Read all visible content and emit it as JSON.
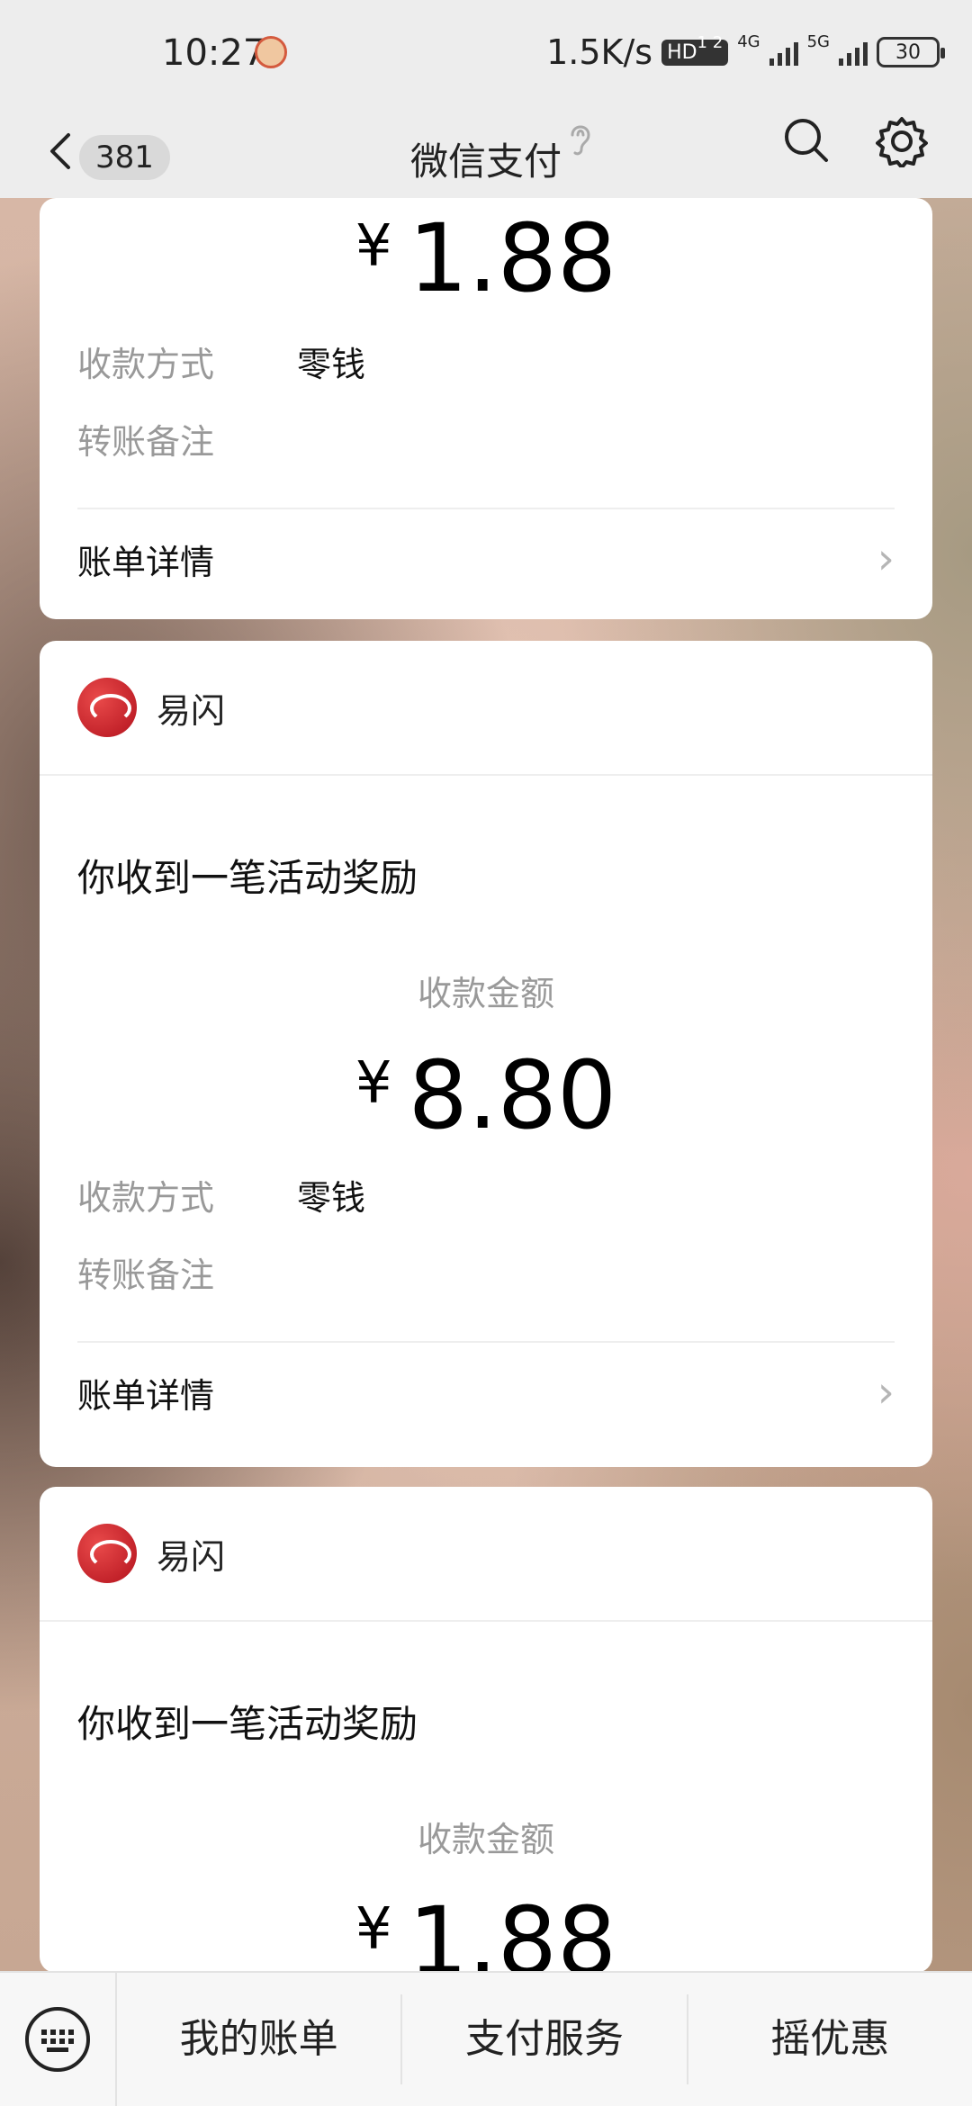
{
  "status_bar": {
    "time": "10:27",
    "network_speed": "1.5K/s",
    "hd_badge": "HD",
    "hd_sub": "1 2",
    "lte_label": "4G",
    "fiveg_label": "5G",
    "battery": "30"
  },
  "nav": {
    "unread_count": "381",
    "title": "微信支付"
  },
  "cards": [
    {
      "amount_sign": "¥",
      "amount": "1.88",
      "method_label": "收款方式",
      "method_value": "零钱",
      "note_label": "转账备注",
      "detail_label": "账单详情"
    },
    {
      "brand": "易闪",
      "title": "你收到一笔活动奖励",
      "amount_label": "收款金额",
      "amount_sign": "¥",
      "amount": "8.80",
      "method_label": "收款方式",
      "method_value": "零钱",
      "note_label": "转账备注",
      "detail_label": "账单详情"
    },
    {
      "brand": "易闪",
      "title": "你收到一笔活动奖励",
      "amount_label": "收款金额",
      "amount_sign": "¥",
      "amount": "1.88"
    }
  ],
  "bottom_tabs": [
    "我的账单",
    "支付服务",
    "摇优惠"
  ],
  "colors": {
    "nav_bg": "#ededed",
    "card_bg": "#ffffff",
    "muted_text": "#999999",
    "brand_red": "#b3121d"
  }
}
